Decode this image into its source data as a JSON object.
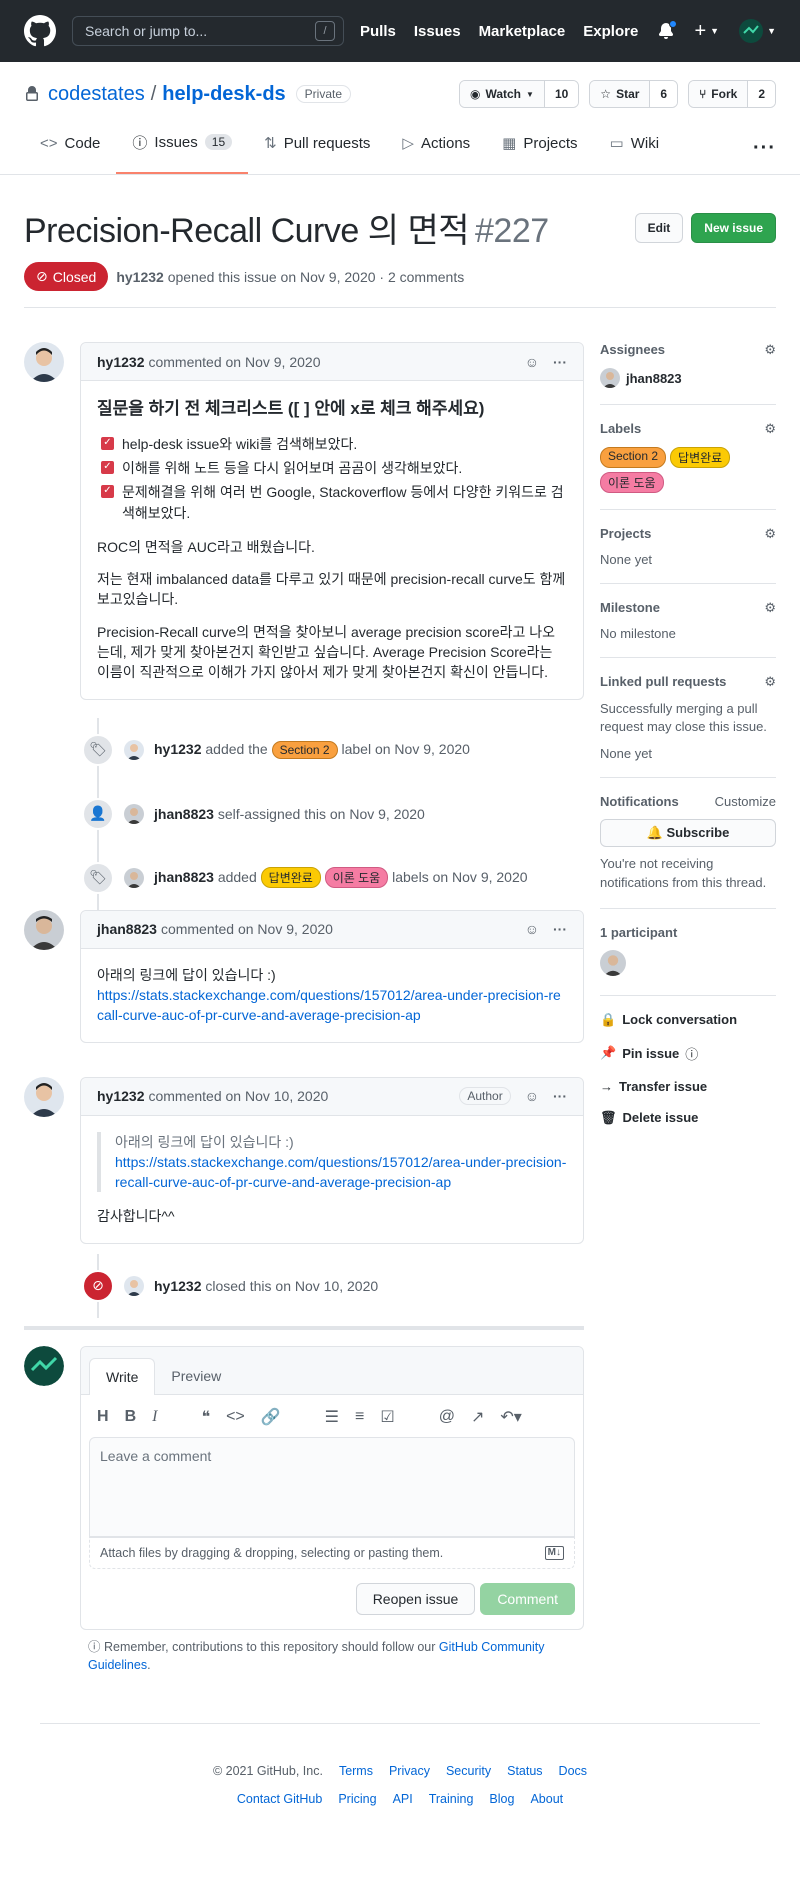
{
  "header": {
    "search_placeholder": "Search or jump to...",
    "search_shortcut": "/",
    "nav": [
      "Pulls",
      "Issues",
      "Marketplace",
      "Explore"
    ]
  },
  "repo": {
    "owner": "codestates",
    "name": "help-desk-ds",
    "visibility": "Private",
    "watch_label": "Watch",
    "watch_count": "10",
    "star_label": "Star",
    "star_count": "6",
    "fork_label": "Fork",
    "fork_count": "2",
    "tabs": [
      {
        "label": "Code"
      },
      {
        "label": "Issues",
        "count": "15"
      },
      {
        "label": "Pull requests"
      },
      {
        "label": "Actions"
      },
      {
        "label": "Projects"
      },
      {
        "label": "Wiki"
      }
    ]
  },
  "issue": {
    "title": "Precision-Recall Curve 의 면적",
    "number": "#227",
    "edit_label": "Edit",
    "new_issue_label": "New issue",
    "state": "Closed",
    "opener": "hy1232",
    "opened_text": "opened this issue on Nov 9, 2020 · 2 comments"
  },
  "comments": [
    {
      "author": "hy1232",
      "meta": "commented on Nov 9, 2020",
      "heading": "질문을 하기 전 체크리스트 ([ ] 안에 x로 체크 해주세요)",
      "checks": [
        "help-desk issue와 wiki를 검색해보았다.",
        "이해를 위해 노트 등을 다시 읽어보며 곰곰이 생각해보았다.",
        "문제해결을 위해 여러 번 Google, Stackoverflow 등에서 다양한 키워드로 검색해보았다."
      ],
      "p1": "ROC의 면적을 AUC라고 배웠습니다.",
      "p2": "저는 현재 imbalanced data를 다루고 있기 때문에 precision-recall curve도 함께 보고있습니다.",
      "p3": "Precision-Recall curve의 면적을 찾아보니 average precision score라고 나오는데, 제가 맞게 찾아본건지 확인받고 싶습니다. Average Precision Score라는 이름이 직관적으로 이해가 가지 않아서 제가 맞게 찾아본건지 확신이 안듭니다."
    },
    {
      "author": "jhan8823",
      "meta": "commented on Nov 9, 2020",
      "text": "아래의 링크에 답이 있습니다 :)",
      "link": "https://stats.stackexchange.com/questions/157012/area-under-precision-recall-curve-auc-of-pr-curve-and-average-precision-ap"
    },
    {
      "author": "hy1232",
      "meta": "commented on Nov 10, 2020",
      "badge": "Author",
      "quote_text": "아래의 링크에 답이 있습니다 :)",
      "quote_link": "https://stats.stackexchange.com/questions/157012/area-under-precision-recall-curve-auc-of-pr-curve-and-average-precision-ap",
      "text": "감사합니다^^"
    }
  ],
  "events": {
    "label_added": {
      "user": "hy1232",
      "pre": "added the",
      "label": "Section 2",
      "post": "label on Nov 9, 2020"
    },
    "assigned": {
      "user": "jhan8823",
      "text": "self-assigned this on Nov 9, 2020"
    },
    "labels_added": {
      "user": "jhan8823",
      "pre": "added",
      "label1": "답변완료",
      "label2": "이론 도움",
      "post": "labels on Nov 9, 2020"
    },
    "closed": {
      "user": "hy1232",
      "text": "closed this on Nov 10, 2020"
    }
  },
  "editor": {
    "tab_write": "Write",
    "tab_preview": "Preview",
    "placeholder": "Leave a comment",
    "attach_text": "Attach files by dragging & dropping, selecting or pasting them.",
    "reopen_label": "Reopen issue",
    "comment_label": "Comment",
    "remember_pre": "Remember, contributions to this repository should follow our",
    "remember_link": "GitHub Community Guidelines",
    "remember_post": "."
  },
  "sidebar": {
    "assignees_title": "Assignees",
    "assignee": "jhan8823",
    "labels_title": "Labels",
    "labels": [
      "Section 2",
      "답변완료",
      "이론 도움"
    ],
    "projects_title": "Projects",
    "projects_value": "None yet",
    "milestone_title": "Milestone",
    "milestone_value": "No milestone",
    "linked_title": "Linked pull requests",
    "linked_desc": "Successfully merging a pull request may close this issue.",
    "linked_value": "None yet",
    "notifications_title": "Notifications",
    "customize_label": "Customize",
    "subscribe_label": "Subscribe",
    "notif_desc": "You're not receiving notifications from this thread.",
    "participants_title": "1 participant",
    "lock_label": "Lock conversation",
    "pin_label": "Pin issue",
    "transfer_label": "Transfer issue",
    "delete_label": "Delete issue"
  },
  "footer": {
    "copyright": "© 2021 GitHub, Inc.",
    "row1": [
      "Terms",
      "Privacy",
      "Security",
      "Status",
      "Docs"
    ],
    "row2": [
      "Contact GitHub",
      "Pricing",
      "API",
      "Training",
      "Blog",
      "About"
    ]
  },
  "colors": {
    "closed": "#cb2431",
    "green": "#2ea44f",
    "link": "#0366d6",
    "tab_underline": "#f9826c"
  }
}
